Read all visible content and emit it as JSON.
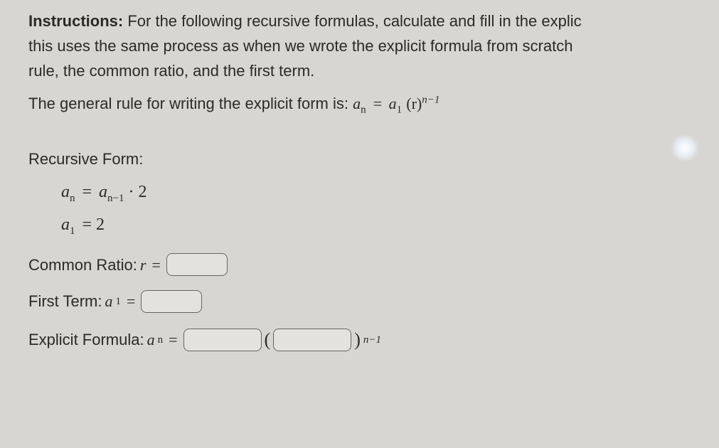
{
  "instructions": {
    "label": "Instructions:",
    "line1": " For the following recursive formulas, calculate and fill in the explic",
    "line2": "this uses the same process as when we wrote the explicit formula from scratch",
    "line3": "rule, the common ratio, and the first term."
  },
  "general_rule": {
    "text": "The general rule for writing the explicit form is: ",
    "formula_an": "a",
    "formula_sub_n": "n",
    "formula_eq": " = ",
    "formula_a1": "a",
    "formula_sub_1": "1",
    "formula_r": "(r)",
    "formula_exp": "n−1"
  },
  "recursive": {
    "title": "Recursive Form:",
    "line1_an": "a",
    "line1_subn": "n",
    "line1_eq": " = ",
    "line1_an1": "a",
    "line1_subn1": "n−1",
    "line1_mult": " · 2",
    "line2_a1": "a",
    "line2_sub1": "1",
    "line2_eq": " = 2"
  },
  "common_ratio": {
    "label": "Common Ratio: ",
    "var": "r",
    "eq": " = "
  },
  "first_term": {
    "label": "First Term: ",
    "var_a": "a",
    "var_sub": "1",
    "eq": " = "
  },
  "explicit": {
    "label": "Explicit Formula: ",
    "var_a": "a",
    "var_sub": "n",
    "eq": " = ",
    "open": " (",
    "close": ")",
    "exp": "n−1"
  }
}
